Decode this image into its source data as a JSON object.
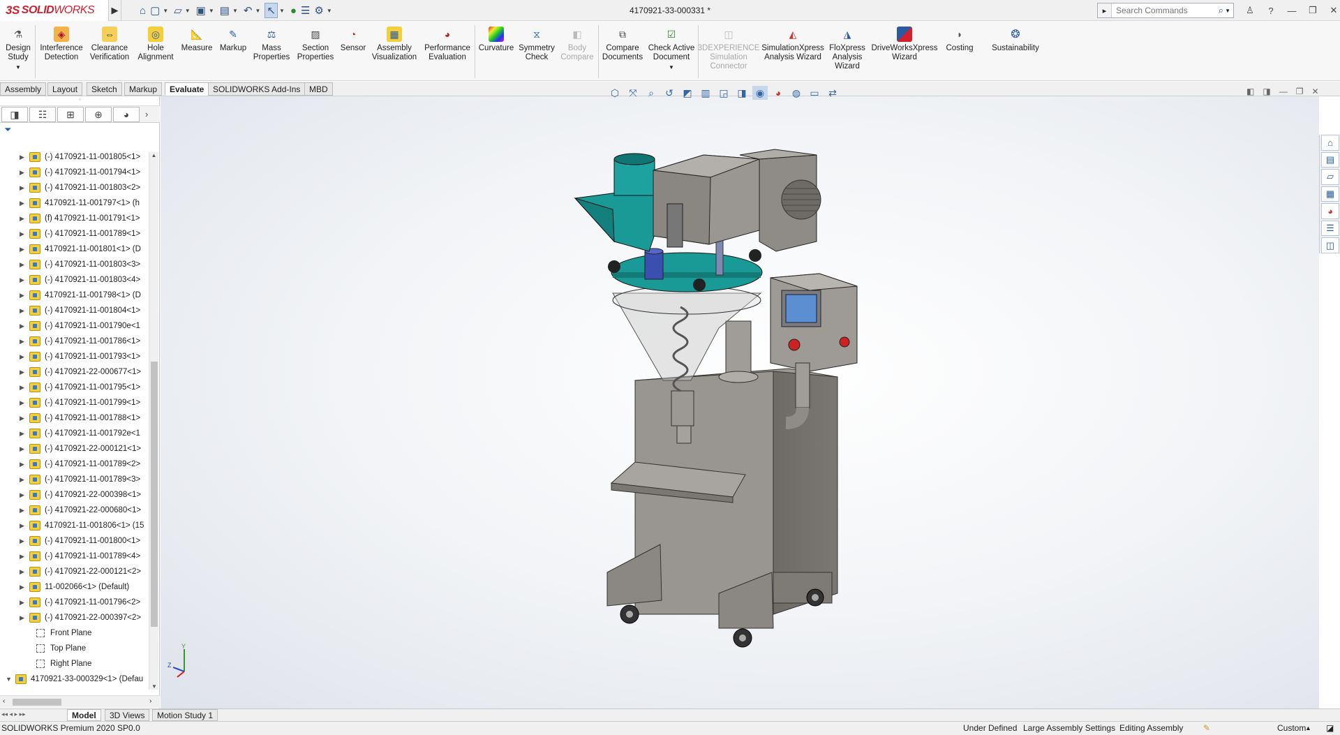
{
  "titlebar": {
    "brand_ds": "3S",
    "brand_solid": "SOLID",
    "brand_works": "WORKS",
    "document_title": "4170921-33-000331 *",
    "search_placeholder": "Search Commands",
    "quick_icons": [
      "home-icon",
      "new-document-icon",
      "open-folder-icon",
      "save-icon",
      "print-icon",
      "undo-icon",
      "select-pointer-icon",
      "rebuild-icon",
      "file-properties-icon",
      "options-gear-icon"
    ]
  },
  "ribbon": {
    "buttons": [
      {
        "label": "Design\nStudy",
        "icon": "design-study-icon",
        "enabled": true
      },
      {
        "label": "Interference\nDetection",
        "icon": "interference-detection-icon",
        "enabled": true
      },
      {
        "label": "Clearance\nVerification",
        "icon": "clearance-verification-icon",
        "enabled": true
      },
      {
        "label": "Hole\nAlignment",
        "icon": "hole-alignment-icon",
        "enabled": true
      },
      {
        "label": "Measure",
        "icon": "measure-icon",
        "enabled": true
      },
      {
        "label": "Markup",
        "icon": "markup-icon",
        "enabled": true
      },
      {
        "label": "Mass\nProperties",
        "icon": "mass-properties-icon",
        "enabled": true
      },
      {
        "label": "Section\nProperties",
        "icon": "section-properties-icon",
        "enabled": true
      },
      {
        "label": "Sensor",
        "icon": "sensor-icon",
        "enabled": true
      },
      {
        "label": "Assembly\nVisualization",
        "icon": "assembly-visualization-icon",
        "enabled": true
      },
      {
        "label": "Performance\nEvaluation",
        "icon": "performance-evaluation-icon",
        "enabled": true
      },
      {
        "label": "Curvature",
        "icon": "curvature-icon",
        "enabled": true
      },
      {
        "label": "Symmetry\nCheck",
        "icon": "symmetry-check-icon",
        "enabled": true
      },
      {
        "label": "Body\nCompare",
        "icon": "body-compare-icon",
        "enabled": false
      },
      {
        "label": "Compare\nDocuments",
        "icon": "compare-documents-icon",
        "enabled": true
      },
      {
        "label": "Check Active\nDocument",
        "icon": "check-active-document-icon",
        "enabled": true
      },
      {
        "label": "3DEXPERIENCE\nSimulation\nConnector",
        "icon": "3dexperience-icon",
        "enabled": false
      },
      {
        "label": "SimulationXpress\nAnalysis Wizard",
        "icon": "simulationxpress-icon",
        "enabled": true
      },
      {
        "label": "FloXpress\nAnalysis\nWizard",
        "icon": "floxpress-icon",
        "enabled": true
      },
      {
        "label": "DriveWorksXpress\nWizard",
        "icon": "driveworksxpress-icon",
        "enabled": true
      },
      {
        "label": "Costing",
        "icon": "costing-icon",
        "enabled": true
      },
      {
        "label": "Sustainability",
        "icon": "sustainability-icon",
        "enabled": true
      }
    ]
  },
  "tabs": [
    "Assembly",
    "Layout",
    "Sketch",
    "Markup",
    "Evaluate",
    "SOLIDWORKS Add-Ins",
    "MBD"
  ],
  "active_tab": "Evaluate",
  "feature_tree": {
    "items": [
      "(-) 4170921-11-001805<1>",
      "(-) 4170921-11-001794<1>",
      "(-) 4170921-11-001803<2>",
      "4170921-11-001797<1> (h",
      "(f) 4170921-11-001791<1>",
      "(-) 4170921-11-001789<1>",
      "4170921-11-001801<1> (D",
      "(-) 4170921-11-001803<3>",
      "(-) 4170921-11-001803<4>",
      "4170921-11-001798<1> (D",
      "(-) 4170921-11-001804<1>",
      "(-) 4170921-11-001790e<1",
      "(-) 4170921-11-001786<1>",
      "(-) 4170921-11-001793<1>",
      "(-) 4170921-22-000677<1>",
      "(-) 4170921-11-001795<1>",
      "(-) 4170921-11-001799<1>",
      "(-) 4170921-11-001788<1>",
      "(-) 4170921-11-001792e<1",
      "(-) 4170921-22-000121<1>",
      "(-) 4170921-11-001789<2>",
      "(-) 4170921-11-001789<3>",
      "(-) 4170921-22-000398<1>",
      "(-) 4170921-22-000680<1>",
      "4170921-11-001806<1> (15",
      "(-) 4170921-11-001800<1>",
      "(-) 4170921-11-001789<4>",
      "(-) 4170921-22-000121<2>",
      "11-002066<1> (Default)",
      "(-) 4170921-11-001796<2>",
      "(-) 4170921-22-000397<2>"
    ],
    "planes": [
      "Front Plane",
      "Top Plane",
      "Right Plane"
    ],
    "root_item": "4170921-33-000329<1> (Defau"
  },
  "bottom_tabs": [
    "Model",
    "3D Views",
    "Motion Study 1"
  ],
  "active_bottom_tab": "Model",
  "status": {
    "version": "SOLIDWORKS Premium 2020 SP0.0",
    "definition": "Under Defined",
    "large_assembly": "Large Assembly Settings",
    "editing": "Editing Assembly",
    "units": "Custom"
  },
  "colors": {
    "brand": "#d1202f",
    "machine_body": "#8f8c88",
    "hopper_teal": "#1a9a96",
    "selection": "#c8d8ec"
  }
}
